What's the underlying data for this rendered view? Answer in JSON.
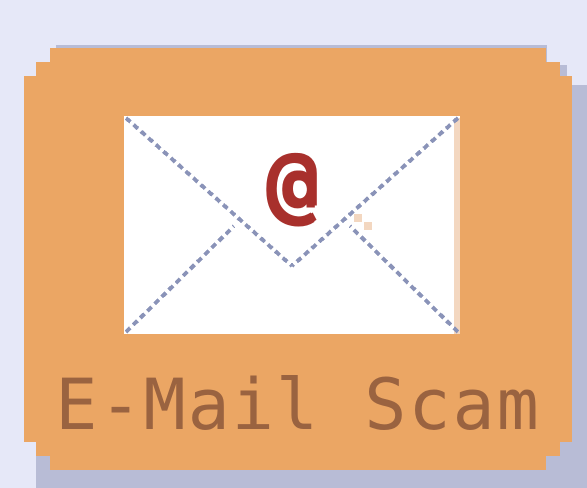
{
  "icon": {
    "label": "E-Mail Scam",
    "glyph": "@",
    "icon_name": "email-envelope-icon",
    "colors": {
      "background": "#e6e8f8",
      "tile": "#eba664",
      "tile_shadow": "#b8bcd6",
      "envelope": "#ffffff",
      "envelope_lines": "#8a93b8",
      "glyph": "#a8302c",
      "label_text": "#9a6340"
    }
  }
}
